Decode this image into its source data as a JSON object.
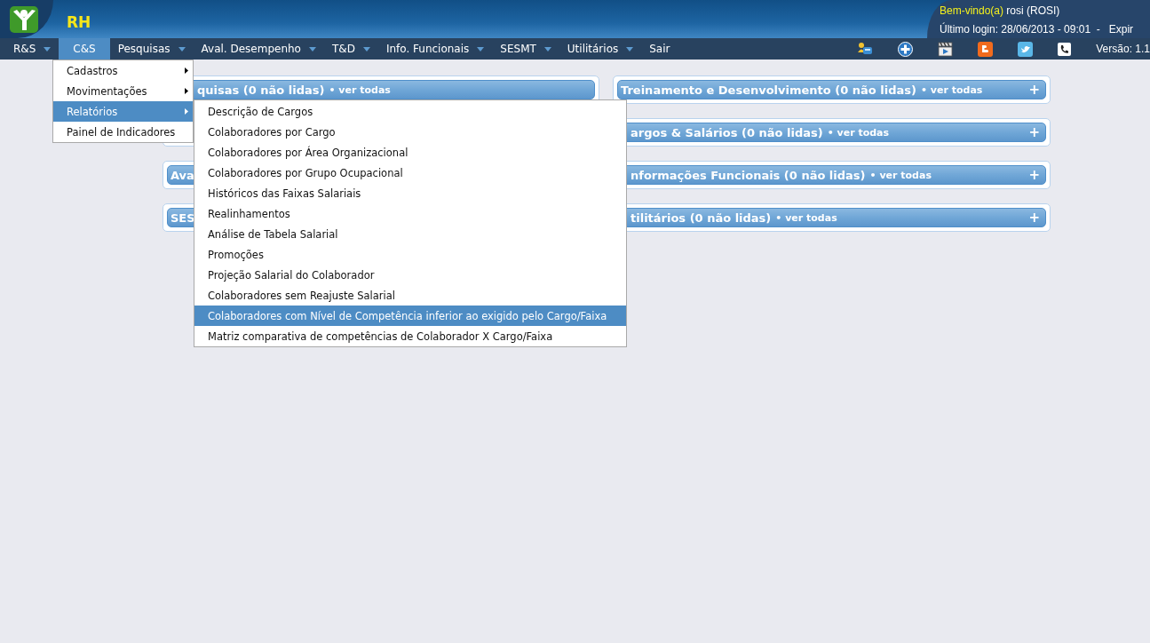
{
  "header": {
    "app_title": "RH",
    "welcome_label": "Bem-vindo(a)",
    "user": "rosi (ROSI)",
    "last_login": "Último login: 28/06/2013 - 09:01  -   Expir"
  },
  "menu_bar": {
    "items": [
      {
        "label": "R&S",
        "has_dropdown": true,
        "selected": false
      },
      {
        "label": "C&S",
        "has_dropdown": false,
        "selected": true
      },
      {
        "label": "Pesquisas",
        "has_dropdown": true,
        "selected": false
      },
      {
        "label": "Aval. Desempenho",
        "has_dropdown": true,
        "selected": false
      },
      {
        "label": "T&D",
        "has_dropdown": true,
        "selected": false
      },
      {
        "label": "Info. Funcionais",
        "has_dropdown": true,
        "selected": false
      },
      {
        "label": "SESMT",
        "has_dropdown": true,
        "selected": false
      },
      {
        "label": "Utilitários",
        "has_dropdown": true,
        "selected": false
      },
      {
        "label": "Sair",
        "has_dropdown": false,
        "selected": false
      }
    ],
    "tools": [
      {
        "kind": "people"
      },
      {
        "kind": "plus"
      },
      {
        "kind": "film"
      },
      {
        "kind": "blog"
      },
      {
        "kind": "bird"
      },
      {
        "kind": "phone"
      }
    ],
    "version": "Versão: 1.1"
  },
  "panels": {
    "left": [
      {
        "kind": "panel",
        "title": "quisas (0 não lidas)",
        "link": "• ver todas"
      },
      {
        "kind": "covered"
      },
      {
        "kind": "panel",
        "title": "Ava"
      },
      {
        "kind": "panel",
        "title": "SES"
      }
    ],
    "right": [
      {
        "kind": "panel",
        "title": "Treinamento e Desenvolvimento (0 não lidas)",
        "link": "• ver todas",
        "expand": "+"
      },
      {
        "kind": "panel",
        "title": "argos & Salários (0 não lidas)",
        "link": "• ver todas",
        "expand": "+"
      },
      {
        "kind": "panel",
        "title": "nformações Funcionais (0 não lidas)",
        "link": "• ver todas",
        "expand": "+"
      },
      {
        "kind": "panel",
        "title": "tilitários (0 não lidas)",
        "link": "• ver todas",
        "expand": "+"
      }
    ]
  },
  "dropdown": {
    "items": [
      {
        "label": "Cadastros",
        "has_submenu": true,
        "selected": false
      },
      {
        "label": "Movimentações",
        "has_submenu": true,
        "selected": false
      },
      {
        "label": "Relatórios",
        "has_submenu": true,
        "selected": true
      },
      {
        "label": "Painel de Indicadores",
        "has_submenu": false,
        "selected": false
      }
    ]
  },
  "submenu": {
    "items": [
      {
        "label": "Descrição de Cargos",
        "selected": false
      },
      {
        "label": "Colaboradores por Cargo",
        "selected": false
      },
      {
        "label": "Colaboradores por Área Organizacional",
        "selected": false
      },
      {
        "label": "Colaboradores por Grupo Ocupacional",
        "selected": false
      },
      {
        "label": "Históricos das Faixas Salariais",
        "selected": false
      },
      {
        "label": "Realinhamentos",
        "selected": false
      },
      {
        "label": "Análise de Tabela Salarial",
        "selected": false
      },
      {
        "label": "Promoções",
        "selected": false
      },
      {
        "label": "Projeção Salarial do Colaborador",
        "selected": false
      },
      {
        "label": "Colaboradores sem Reajuste Salarial",
        "selected": false
      },
      {
        "label": "Colaboradores com Nível de Competência inferior ao exigido pelo Cargo/Faixa",
        "selected": true
      },
      {
        "label": "Matriz comparativa de competências de Colaborador X Cargo/Faixa",
        "selected": false
      }
    ]
  }
}
